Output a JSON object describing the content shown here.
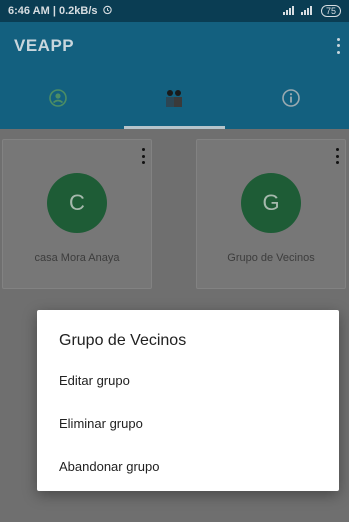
{
  "status_bar": {
    "time": "6:46 AM | 0.2kB/s",
    "battery": "75"
  },
  "app_bar": {
    "title": "VEAPP"
  },
  "tabs": [
    {
      "icon": "person-group-icon",
      "active": false
    },
    {
      "icon": "people-icon",
      "active": true
    },
    {
      "icon": "info-icon",
      "active": false
    }
  ],
  "groups": [
    {
      "initial": "C",
      "name": "casa Mora Anaya"
    },
    {
      "initial": "G",
      "name": "Grupo de Vecinos"
    }
  ],
  "dialog": {
    "title": "Grupo de Vecinos",
    "items": [
      {
        "label": "Editar grupo"
      },
      {
        "label": "Eliminar grupo"
      },
      {
        "label": "Abandonar grupo"
      }
    ]
  },
  "colors": {
    "app_bar": "#13607f",
    "status_bar": "#0a3d53",
    "avatar": "#1e5c36",
    "scrim_background": "#6f6f6f"
  }
}
